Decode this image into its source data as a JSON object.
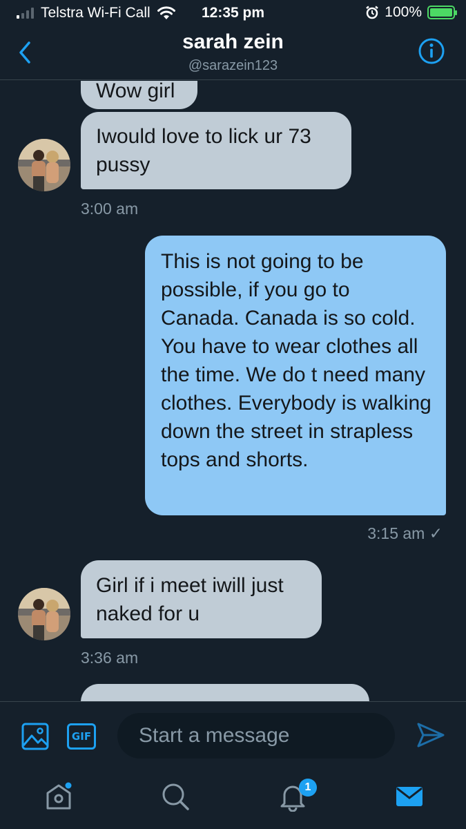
{
  "status_bar": {
    "carrier": "Telstra Wi-Fi Call",
    "time": "12:35 pm",
    "battery": "100%",
    "battery_level": 1.0
  },
  "header": {
    "name": "sarah zein",
    "handle": "@sarazein123"
  },
  "messages": [
    {
      "direction": "received",
      "text": "Wow girl"
    },
    {
      "direction": "received",
      "text": "Iwould love to lick ur 73 pussy",
      "timestamp": "3:00 am"
    },
    {
      "direction": "sent",
      "text": "This is not going to be possible, if you go to Canada. Canada is so cold. You have to wear clothes all the time. We do t need many clothes. Everybody is walking down the street in strapless tops and shorts.",
      "timestamp": "3:15 am ✓"
    },
    {
      "direction": "received",
      "text": "Girl if i meet iwill just naked for u",
      "timestamp": "3:36 am"
    }
  ],
  "composer": {
    "placeholder": "Start a message",
    "gif_label": "GIF"
  },
  "tabbar": {
    "items": [
      "home",
      "search",
      "notifications",
      "messages"
    ],
    "notification_count": "1"
  },
  "colors": {
    "background": "#15202b",
    "received_bubble": "#c0ccd6",
    "sent_bubble": "#8ec8f5",
    "accent": "#1da1f2"
  }
}
